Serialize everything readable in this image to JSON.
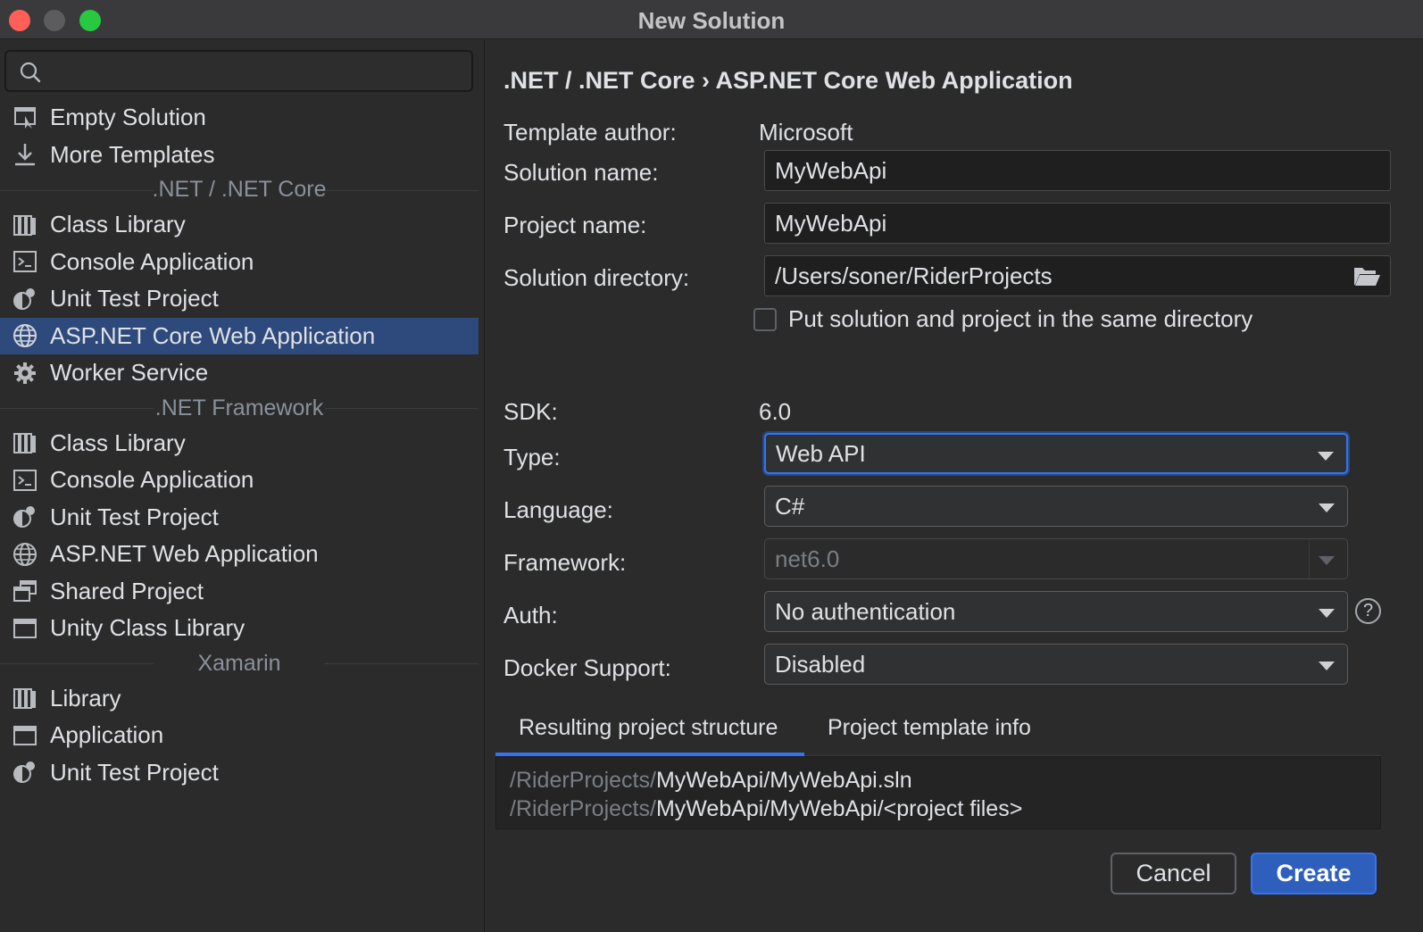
{
  "window": {
    "title": "New Solution"
  },
  "search": {
    "value": "",
    "placeholder": ""
  },
  "sidebar": {
    "top_items": [
      {
        "label": "Empty Solution",
        "icon": "empty-solution-icon"
      },
      {
        "label": "More Templates",
        "icon": "download-icon"
      }
    ],
    "groups": [
      {
        "title": ".NET / .NET Core",
        "items": [
          {
            "label": "Class Library",
            "icon": "library-icon"
          },
          {
            "label": "Console Application",
            "icon": "console-icon"
          },
          {
            "label": "Unit Test Project",
            "icon": "unit-test-icon"
          },
          {
            "label": "ASP.NET Core Web Application",
            "icon": "globe-icon",
            "selected": true
          },
          {
            "label": "Worker Service",
            "icon": "gear-icon"
          }
        ]
      },
      {
        "title": ".NET Framework",
        "items": [
          {
            "label": "Class Library",
            "icon": "library-icon"
          },
          {
            "label": "Console Application",
            "icon": "console-icon"
          },
          {
            "label": "Unit Test Project",
            "icon": "unit-test-icon"
          },
          {
            "label": "ASP.NET Web Application",
            "icon": "globe-icon"
          },
          {
            "label": "Shared Project",
            "icon": "shared-project-icon"
          },
          {
            "label": "Unity Class Library",
            "icon": "window-icon"
          }
        ]
      },
      {
        "title": "Xamarin",
        "items": [
          {
            "label": "Library",
            "icon": "library-icon"
          },
          {
            "label": "Application",
            "icon": "window-icon"
          },
          {
            "label": "Unit Test Project",
            "icon": "unit-test-icon"
          }
        ]
      }
    ]
  },
  "main": {
    "breadcrumb": ".NET / .NET Core › ASP.NET Core Web Application",
    "template_author_label": "Template author:",
    "template_author": "Microsoft",
    "solution_name_label": "Solution name:",
    "solution_name": "MyWebApi",
    "project_name_label": "Project name:",
    "project_name": "MyWebApi",
    "solution_dir_label": "Solution directory:",
    "solution_dir": "/Users/soner/RiderProjects",
    "same_dir_label": "Put solution and project in the same directory",
    "same_dir_checked": false,
    "sdk_label": "SDK:",
    "sdk": "6.0",
    "type_label": "Type:",
    "type": "Web API",
    "language_label": "Language:",
    "language": "C#",
    "framework_label": "Framework:",
    "framework": "net6.0",
    "auth_label": "Auth:",
    "auth": "No authentication",
    "docker_label": "Docker Support:",
    "docker": "Disabled",
    "help": "?",
    "tabs": [
      "Resulting project structure",
      "Project template info"
    ],
    "structure": [
      {
        "dim": "/RiderProjects/",
        "bright": "MyWebApi/MyWebApi.sln"
      },
      {
        "dim": "/RiderProjects/",
        "bright": "MyWebApi/MyWebApi/<project files>"
      }
    ],
    "cancel_label": "Cancel",
    "create_label": "Create"
  },
  "colors": {
    "accent": "#3574f0",
    "selection": "#2e4a7c",
    "background": "#2b2b2b",
    "close": "#ff5f57",
    "maximize": "#28c840"
  }
}
